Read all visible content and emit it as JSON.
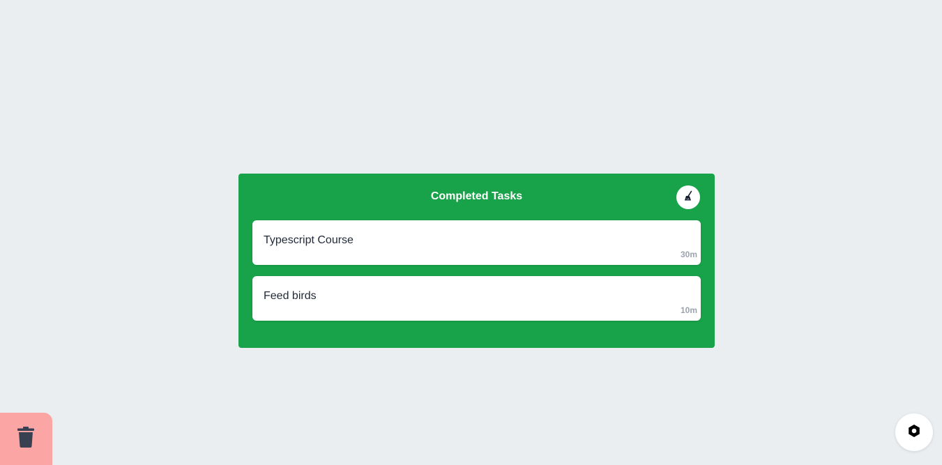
{
  "panel": {
    "title": "Completed Tasks",
    "clear_icon": "broom-icon",
    "tasks": [
      {
        "name": "Typescript Course",
        "duration": "30m"
      },
      {
        "name": "Feed birds",
        "duration": "10m"
      }
    ]
  },
  "trash": {
    "icon": "trash-icon"
  },
  "settings": {
    "icon": "gear-icon"
  },
  "colors": {
    "background": "#ebeef1",
    "panel": "#18a34a",
    "trash_zone": "#fca5a5",
    "icon_dark": "#374151",
    "duration_text": "#9ca3af"
  }
}
